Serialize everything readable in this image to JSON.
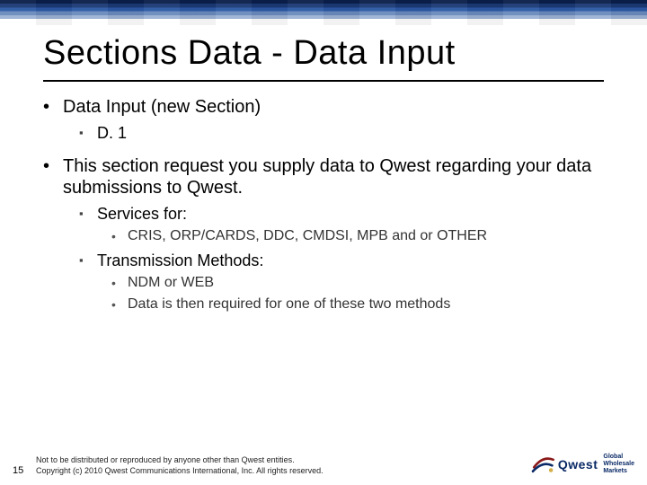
{
  "title": "Sections Data - Data Input",
  "bullets": [
    {
      "text": "Data Input (new Section)",
      "children": [
        {
          "text": "D. 1"
        }
      ]
    },
    {
      "text": "This section request you supply data to Qwest regarding your data submissions to Qwest.",
      "children": [
        {
          "text": "Services for:",
          "children": [
            {
              "text": "CRIS, ORP/CARDS, DDC, CMDSI, MPB and or OTHER"
            }
          ]
        },
        {
          "text": "Transmission Methods:",
          "children": [
            {
              "text": "NDM or WEB"
            },
            {
              "text": "Data is then required for one of these two methods"
            }
          ]
        }
      ]
    }
  ],
  "footer": {
    "page_number": "15",
    "legal_line1": "Not to be distributed or reproduced by anyone other than Qwest entities.",
    "legal_line2": "Copyright (c) 2010 Qwest Communications International, Inc. All rights reserved."
  },
  "logo": {
    "brand": "Qwest",
    "tagline_line1": "Global",
    "tagline_line2": "Wholesale",
    "tagline_line3": "Markets"
  },
  "markers": {
    "lvl1": "•",
    "lvl2": "▪",
    "lvl3": "•"
  }
}
